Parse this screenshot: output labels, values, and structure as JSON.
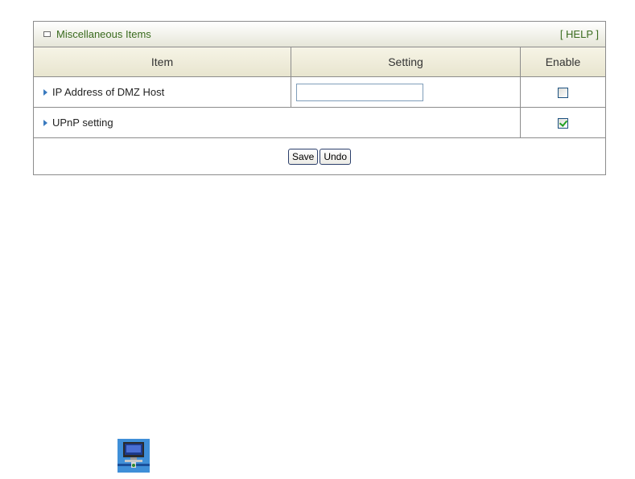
{
  "panel": {
    "title": "Miscellaneous Items",
    "help_label": "[ HELP ]"
  },
  "table": {
    "headers": {
      "item": "Item",
      "setting": "Setting",
      "enable": "Enable"
    },
    "rows": [
      {
        "label": "IP Address of DMZ Host",
        "input_value": "",
        "enabled": false
      },
      {
        "label": "UPnP setting",
        "enabled": true
      }
    ]
  },
  "buttons": {
    "save": "Save",
    "undo": "Undo"
  },
  "icons": {
    "header_bullet": "square-bullet-icon",
    "row_bullet": "triangle-arrow-icon",
    "bottom": "computer-network-icon"
  },
  "colors": {
    "title_green": "#3a6b1e",
    "arrow_blue": "#3a7abf",
    "check_green": "#21a121"
  }
}
